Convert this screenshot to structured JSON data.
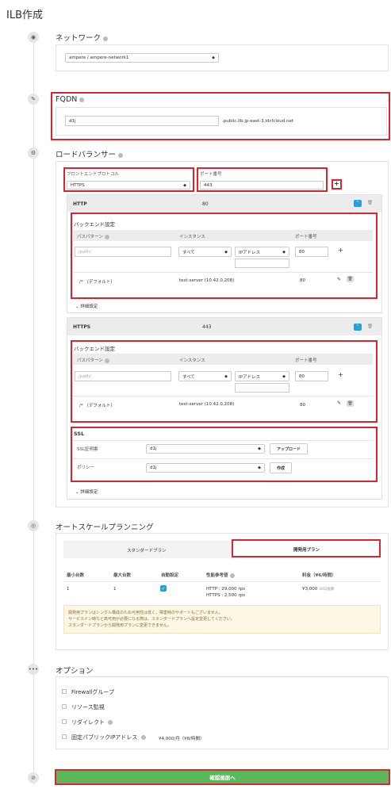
{
  "page": {
    "title": "ILB作成"
  },
  "network": {
    "title": "ネットワーク",
    "select": "ampere / ampere-network1"
  },
  "fqdn": {
    "title": "FQDN",
    "value": "d1j",
    "suffix": ".public.ilb.jp-east-3.idcfcloud.net"
  },
  "lb": {
    "title": "ロードバランサー",
    "protocol_label": "フロントエンドプロトコル",
    "protocol_value": "HTTPS",
    "port_label": "ポート番号",
    "port_value": "443",
    "add": "+"
  },
  "http_panel": {
    "name": "HTTP",
    "port": "80",
    "backend_title": "バックエンド設定",
    "headers": [
      "パスパターン",
      "インスタンス",
      "ポート番号"
    ],
    "path_placeholder": "/path/",
    "inst_select": "すべて",
    "ip_select": "IPアドレス",
    "port_value": "80",
    "row": {
      "path": "/* （デフォルト）",
      "instance": "test-server (10.42.0.208)",
      "port": "80"
    },
    "detail": "詳細設定"
  },
  "https_panel": {
    "name": "HTTPS",
    "port": "443",
    "backend_title": "バックエンド設定",
    "headers": [
      "パスパターン",
      "インスタンス",
      "ポート番号"
    ],
    "path_placeholder": "/path/",
    "inst_select": "すべて",
    "ip_select": "IPアドレス",
    "port_value": "80",
    "row": {
      "path": "/* （デフォルト）",
      "instance": "test-server (10.42.0.208)",
      "port": "80"
    },
    "ssl_title": "SSL",
    "cert_label": "SSL証明書",
    "cert_value": "d1j",
    "upload": "アップロード",
    "policy_label": "ポリシー",
    "policy_value": "d1j",
    "create": "作成",
    "detail": "詳細設定"
  },
  "autoscale": {
    "title": "オートスケールプランニング",
    "tab_standard": "スタンダードプラン",
    "tab_dev": "開発用プラン",
    "headers": {
      "min": "最小台数",
      "max": "最大台数",
      "auto": "自動設定",
      "perf": "性能参考値",
      "price": "料金（¥6/時間）"
    },
    "row": {
      "min": "1",
      "max": "1",
      "perf1": "HTTP : 29,000 rps",
      "perf2": "HTTPS : 2,500 rps",
      "price": "¥3,000",
      "price_note": "30日換算"
    },
    "note1": "開発用プランはシングル構成のため可用性は低く、障害時のサポートもございません。",
    "note2": "サービスイン時など高可用が必要になる際は、スタンダードプランへ設定変更してください。",
    "note3": "スタンダードプランから開発用プランに変更できません。"
  },
  "options": {
    "title": "オプション",
    "firewall": "Firewallグループ",
    "monitor": "リソース監視",
    "redirect": "リダイレクト",
    "fixed_ip": "固定パブリックIPアドレス",
    "fixed_ip_price": "¥4,000/月（¥8/時間）"
  },
  "confirm": {
    "label": "確認画面へ"
  },
  "colors": {
    "accent": "#2a9fd6",
    "confirm": "#5cb85c",
    "highlight": "#d9252f",
    "note_bg": "#fcf8e3"
  }
}
